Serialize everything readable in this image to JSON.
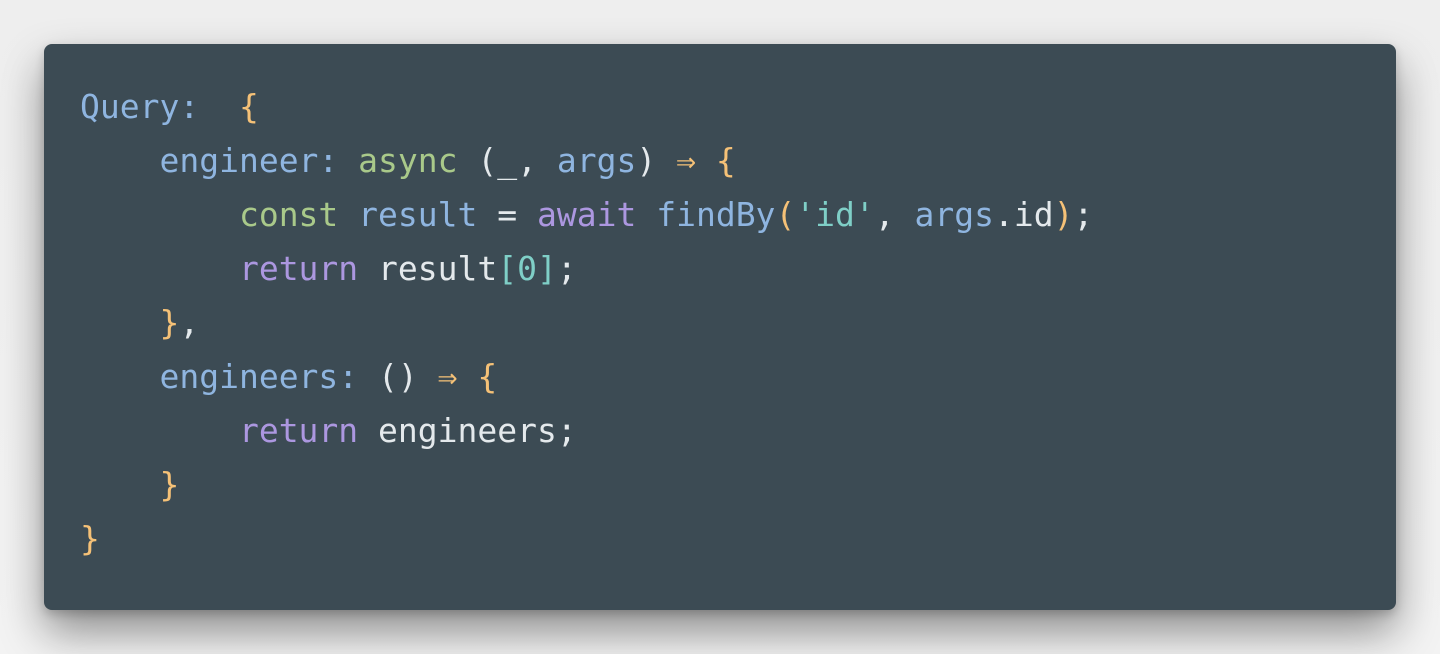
{
  "colors": {
    "background": "#f0f0f0",
    "editor_bg": "#3c4b54",
    "key": "#8fb5e0",
    "brace": "#f5c177",
    "keyword": "#a9c98a",
    "control_keyword": "#ac97e0",
    "string": "#7fcfc7",
    "plain": "#e4e9ec"
  },
  "code": {
    "lines": [
      [
        {
          "text": "Query:",
          "kind": "key"
        },
        {
          "text": "  ",
          "kind": "plain"
        },
        {
          "text": "{",
          "kind": "brace"
        }
      ],
      [
        {
          "text": "    ",
          "kind": "plain"
        },
        {
          "text": "engineer:",
          "kind": "key"
        },
        {
          "text": " ",
          "kind": "plain"
        },
        {
          "text": "async",
          "kind": "kw"
        },
        {
          "text": " (_, ",
          "kind": "plain"
        },
        {
          "text": "args",
          "kind": "var"
        },
        {
          "text": ") ",
          "kind": "plain"
        },
        {
          "text": "⇒",
          "kind": "brace"
        },
        {
          "text": " ",
          "kind": "plain"
        },
        {
          "text": "{",
          "kind": "brace"
        }
      ],
      [
        {
          "text": "        ",
          "kind": "plain"
        },
        {
          "text": "const",
          "kind": "kw"
        },
        {
          "text": " ",
          "kind": "plain"
        },
        {
          "text": "result",
          "kind": "var"
        },
        {
          "text": " = ",
          "kind": "plain"
        },
        {
          "text": "await",
          "kind": "kw2"
        },
        {
          "text": " ",
          "kind": "plain"
        },
        {
          "text": "findBy",
          "kind": "fn"
        },
        {
          "text": "(",
          "kind": "brace"
        },
        {
          "text": "'id'",
          "kind": "str"
        },
        {
          "text": ", ",
          "kind": "plain"
        },
        {
          "text": "args",
          "kind": "var"
        },
        {
          "text": ".id",
          "kind": "plain"
        },
        {
          "text": ")",
          "kind": "brace"
        },
        {
          "text": ";",
          "kind": "plain"
        }
      ],
      [
        {
          "text": "        ",
          "kind": "plain"
        },
        {
          "text": "return",
          "kind": "kw2"
        },
        {
          "text": " result",
          "kind": "plain"
        },
        {
          "text": "[",
          "kind": "str"
        },
        {
          "text": "0",
          "kind": "num"
        },
        {
          "text": "]",
          "kind": "str"
        },
        {
          "text": ";",
          "kind": "plain"
        }
      ],
      [
        {
          "text": "    ",
          "kind": "plain"
        },
        {
          "text": "}",
          "kind": "brace"
        },
        {
          "text": ",",
          "kind": "plain"
        }
      ],
      [
        {
          "text": "    ",
          "kind": "plain"
        },
        {
          "text": "engineers:",
          "kind": "key"
        },
        {
          "text": " () ",
          "kind": "plain"
        },
        {
          "text": "⇒",
          "kind": "brace"
        },
        {
          "text": " ",
          "kind": "plain"
        },
        {
          "text": "{",
          "kind": "brace"
        }
      ],
      [
        {
          "text": "        ",
          "kind": "plain"
        },
        {
          "text": "return",
          "kind": "kw2"
        },
        {
          "text": " engineers;",
          "kind": "plain"
        }
      ],
      [
        {
          "text": "    ",
          "kind": "plain"
        },
        {
          "text": "}",
          "kind": "brace"
        }
      ],
      [
        {
          "text": "}",
          "kind": "brace"
        }
      ]
    ]
  }
}
